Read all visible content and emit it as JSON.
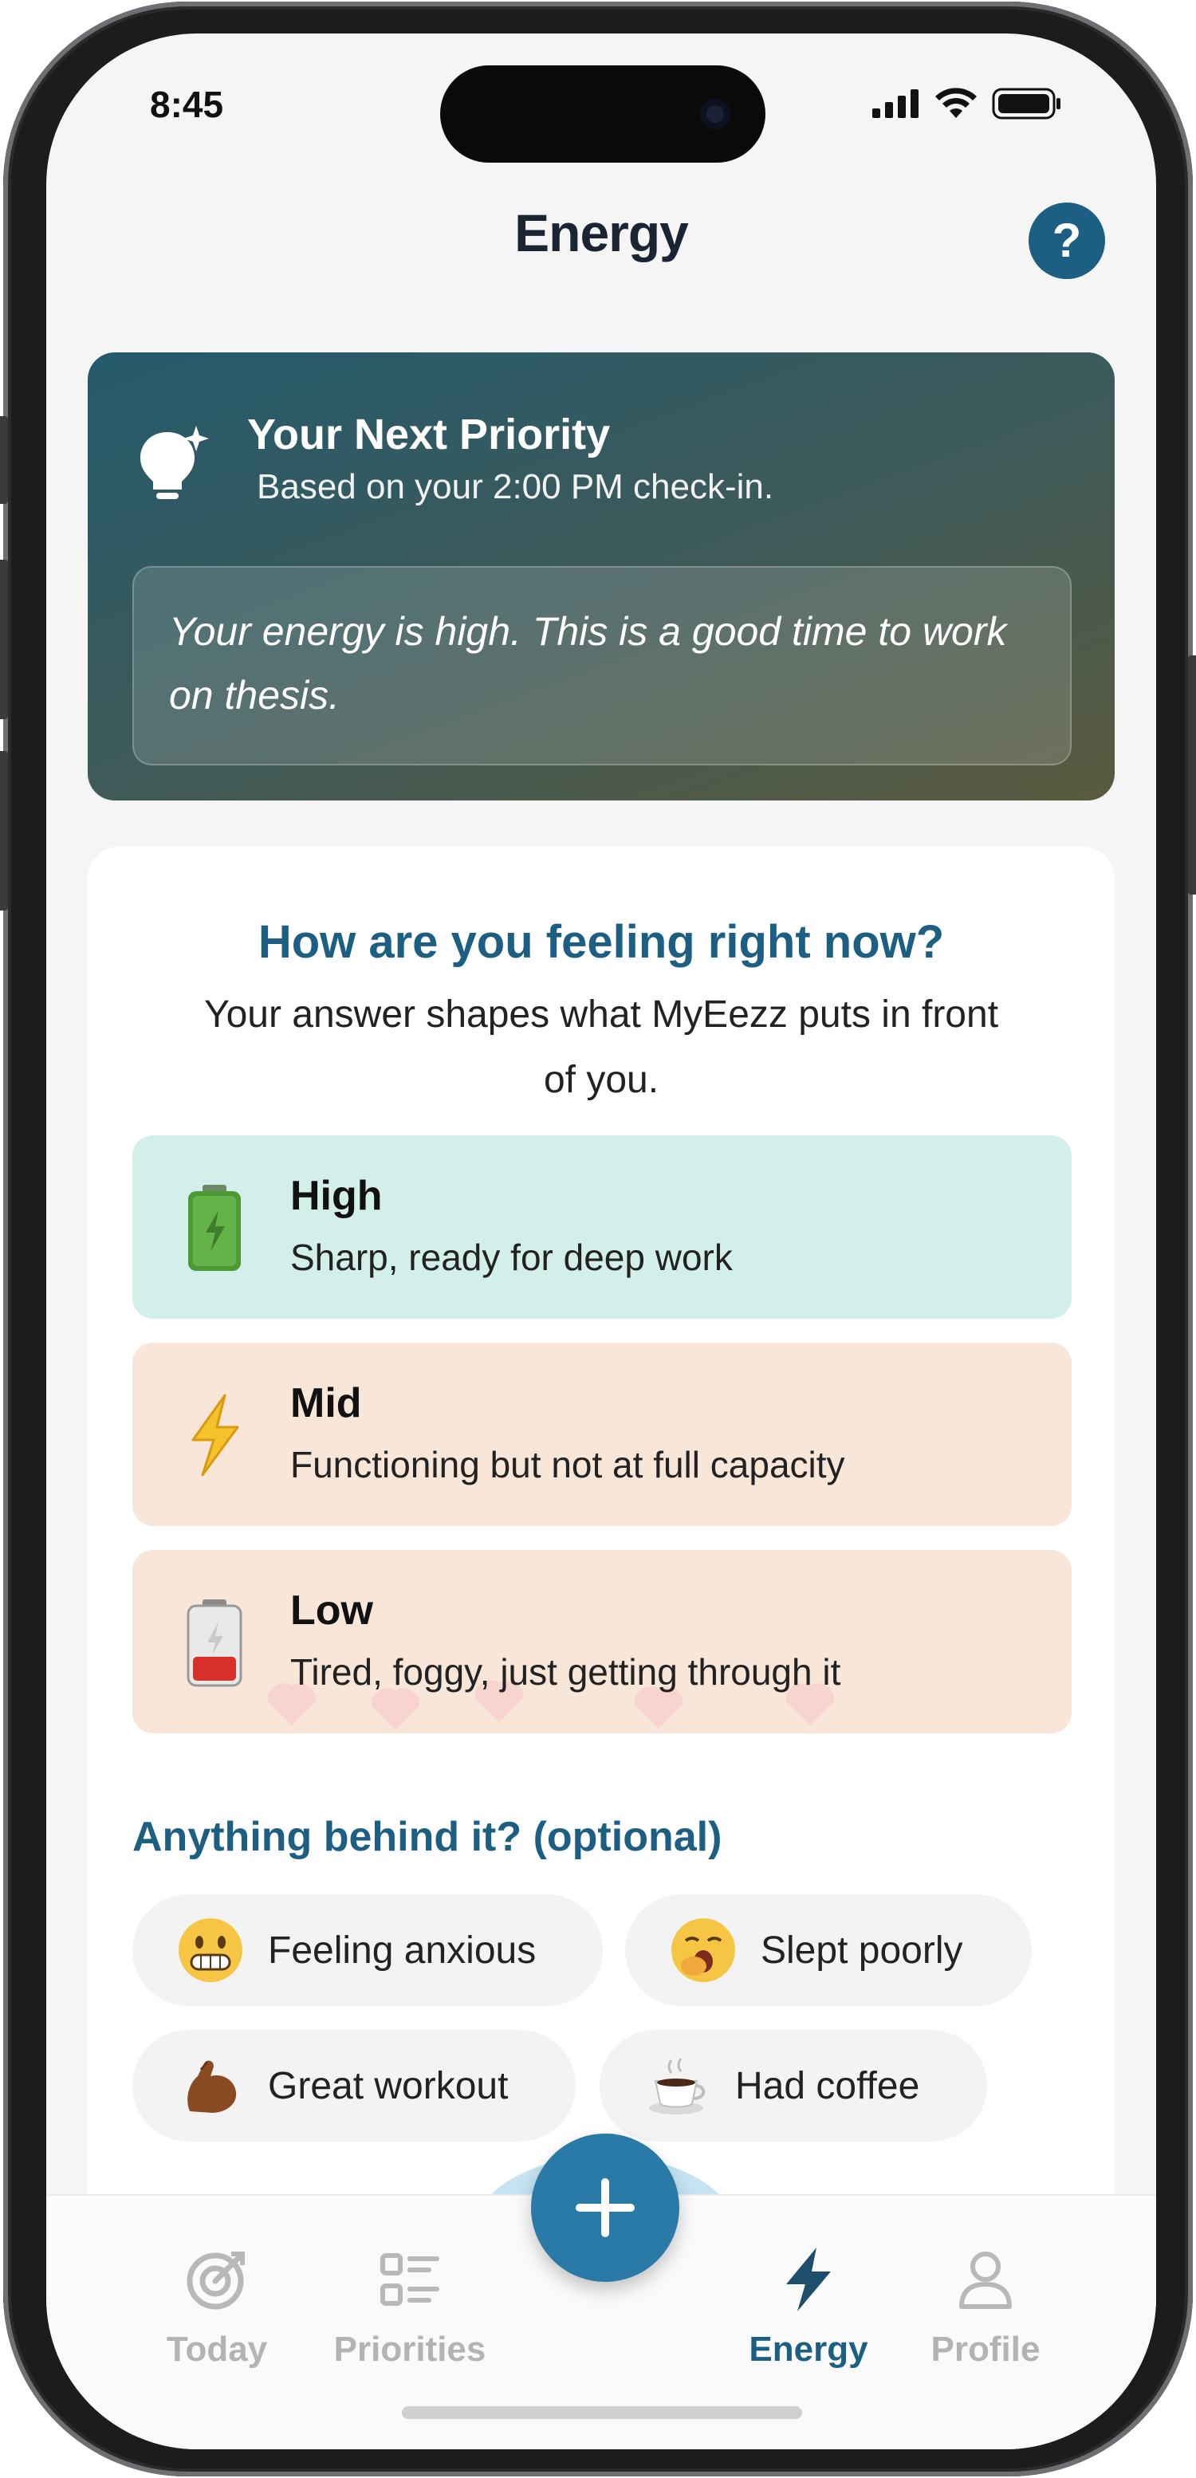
{
  "status_bar": {
    "time": "8:45"
  },
  "header": {
    "title": "Energy",
    "help_label": "?"
  },
  "priority": {
    "title": "Your Next Priority",
    "subtitle": "Based on your 2:00 PM check-in.",
    "message": "Your energy is high. This is a good time to work on thesis."
  },
  "feeling": {
    "question": "How are you feeling right now?",
    "subtitle": "Your answer shapes what MyEezz puts in front of you.",
    "options": [
      {
        "label": "High",
        "desc": "Sharp, ready for deep work",
        "icon": "battery-full-icon",
        "color": "#d2efea"
      },
      {
        "label": "Mid",
        "desc": "Functioning but not at full capacity",
        "icon": "lightning-icon",
        "color": "#f8e6d8"
      },
      {
        "label": "Low",
        "desc": "Tired, foggy, just getting through it",
        "icon": "battery-low-icon",
        "color": "#f8e6d8"
      }
    ]
  },
  "behind": {
    "title": "Anything behind it? (optional)",
    "chips": [
      {
        "label": "Feeling anxious",
        "icon": "grimace-emoji"
      },
      {
        "label": "Slept poorly",
        "icon": "yawn-emoji"
      },
      {
        "label": "Great workout",
        "icon": "flexed-bicep-emoji"
      },
      {
        "label": "Had coffee",
        "icon": "coffee-emoji"
      }
    ]
  },
  "tabs": [
    {
      "label": "Today",
      "icon": "target-icon"
    },
    {
      "label": "Priorities",
      "icon": "list-icon"
    },
    {
      "label": "Energy",
      "icon": "bolt-icon",
      "active": true
    },
    {
      "label": "Profile",
      "icon": "person-icon"
    }
  ],
  "fab": {
    "icon": "plus-icon"
  },
  "colors": {
    "accent": "#1d5f82",
    "fab": "#2a7aa8"
  }
}
